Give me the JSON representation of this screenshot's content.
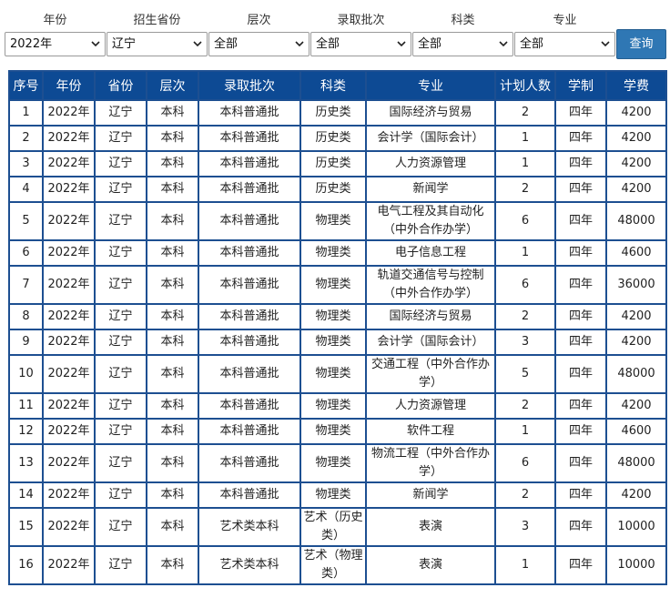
{
  "filters": [
    {
      "key": "year",
      "label": "年份",
      "value": "2022年"
    },
    {
      "key": "province",
      "label": "招生省份",
      "value": "辽宁"
    },
    {
      "key": "level",
      "label": "层次",
      "value": "全部"
    },
    {
      "key": "batch",
      "label": "录取批次",
      "value": "全部"
    },
    {
      "key": "category",
      "label": "科类",
      "value": "全部"
    },
    {
      "key": "major",
      "label": "专业",
      "value": "全部"
    }
  ],
  "query_button": "查询",
  "table": {
    "headers": [
      "序号",
      "年份",
      "省份",
      "层次",
      "录取批次",
      "科类",
      "专业",
      "计划人数",
      "学制",
      "学费"
    ],
    "rows": [
      [
        "1",
        "2022年",
        "辽宁",
        "本科",
        "本科普通批",
        "历史类",
        "国际经济与贸易",
        "2",
        "四年",
        "4200"
      ],
      [
        "2",
        "2022年",
        "辽宁",
        "本科",
        "本科普通批",
        "历史类",
        "会计学（国际会计）",
        "1",
        "四年",
        "4200"
      ],
      [
        "3",
        "2022年",
        "辽宁",
        "本科",
        "本科普通批",
        "历史类",
        "人力资源管理",
        "1",
        "四年",
        "4200"
      ],
      [
        "4",
        "2022年",
        "辽宁",
        "本科",
        "本科普通批",
        "历史类",
        "新闻学",
        "2",
        "四年",
        "4200"
      ],
      [
        "5",
        "2022年",
        "辽宁",
        "本科",
        "本科普通批",
        "物理类",
        "电气工程及其自动化（中外合作办学）",
        "6",
        "四年",
        "48000"
      ],
      [
        "6",
        "2022年",
        "辽宁",
        "本科",
        "本科普通批",
        "物理类",
        "电子信息工程",
        "1",
        "四年",
        "4600"
      ],
      [
        "7",
        "2022年",
        "辽宁",
        "本科",
        "本科普通批",
        "物理类",
        "轨道交通信号与控制（中外合作办学）",
        "6",
        "四年",
        "36000"
      ],
      [
        "8",
        "2022年",
        "辽宁",
        "本科",
        "本科普通批",
        "物理类",
        "国际经济与贸易",
        "2",
        "四年",
        "4200"
      ],
      [
        "9",
        "2022年",
        "辽宁",
        "本科",
        "本科普通批",
        "物理类",
        "会计学（国际会计）",
        "3",
        "四年",
        "4200"
      ],
      [
        "10",
        "2022年",
        "辽宁",
        "本科",
        "本科普通批",
        "物理类",
        "交通工程（中外合作办学）",
        "5",
        "四年",
        "48000"
      ],
      [
        "11",
        "2022年",
        "辽宁",
        "本科",
        "本科普通批",
        "物理类",
        "人力资源管理",
        "2",
        "四年",
        "4200"
      ],
      [
        "12",
        "2022年",
        "辽宁",
        "本科",
        "本科普通批",
        "物理类",
        "软件工程",
        "1",
        "四年",
        "4600"
      ],
      [
        "13",
        "2022年",
        "辽宁",
        "本科",
        "本科普通批",
        "物理类",
        "物流工程（中外合作办学）",
        "6",
        "四年",
        "48000"
      ],
      [
        "14",
        "2022年",
        "辽宁",
        "本科",
        "本科普通批",
        "物理类",
        "新闻学",
        "2",
        "四年",
        "4200"
      ],
      [
        "15",
        "2022年",
        "辽宁",
        "本科",
        "艺术类本科",
        "艺术（历史类）",
        "表演",
        "3",
        "四年",
        "10000"
      ],
      [
        "16",
        "2022年",
        "辽宁",
        "本科",
        "艺术类本科",
        "艺术（物理类）",
        "表演",
        "1",
        "四年",
        "10000"
      ]
    ]
  }
}
